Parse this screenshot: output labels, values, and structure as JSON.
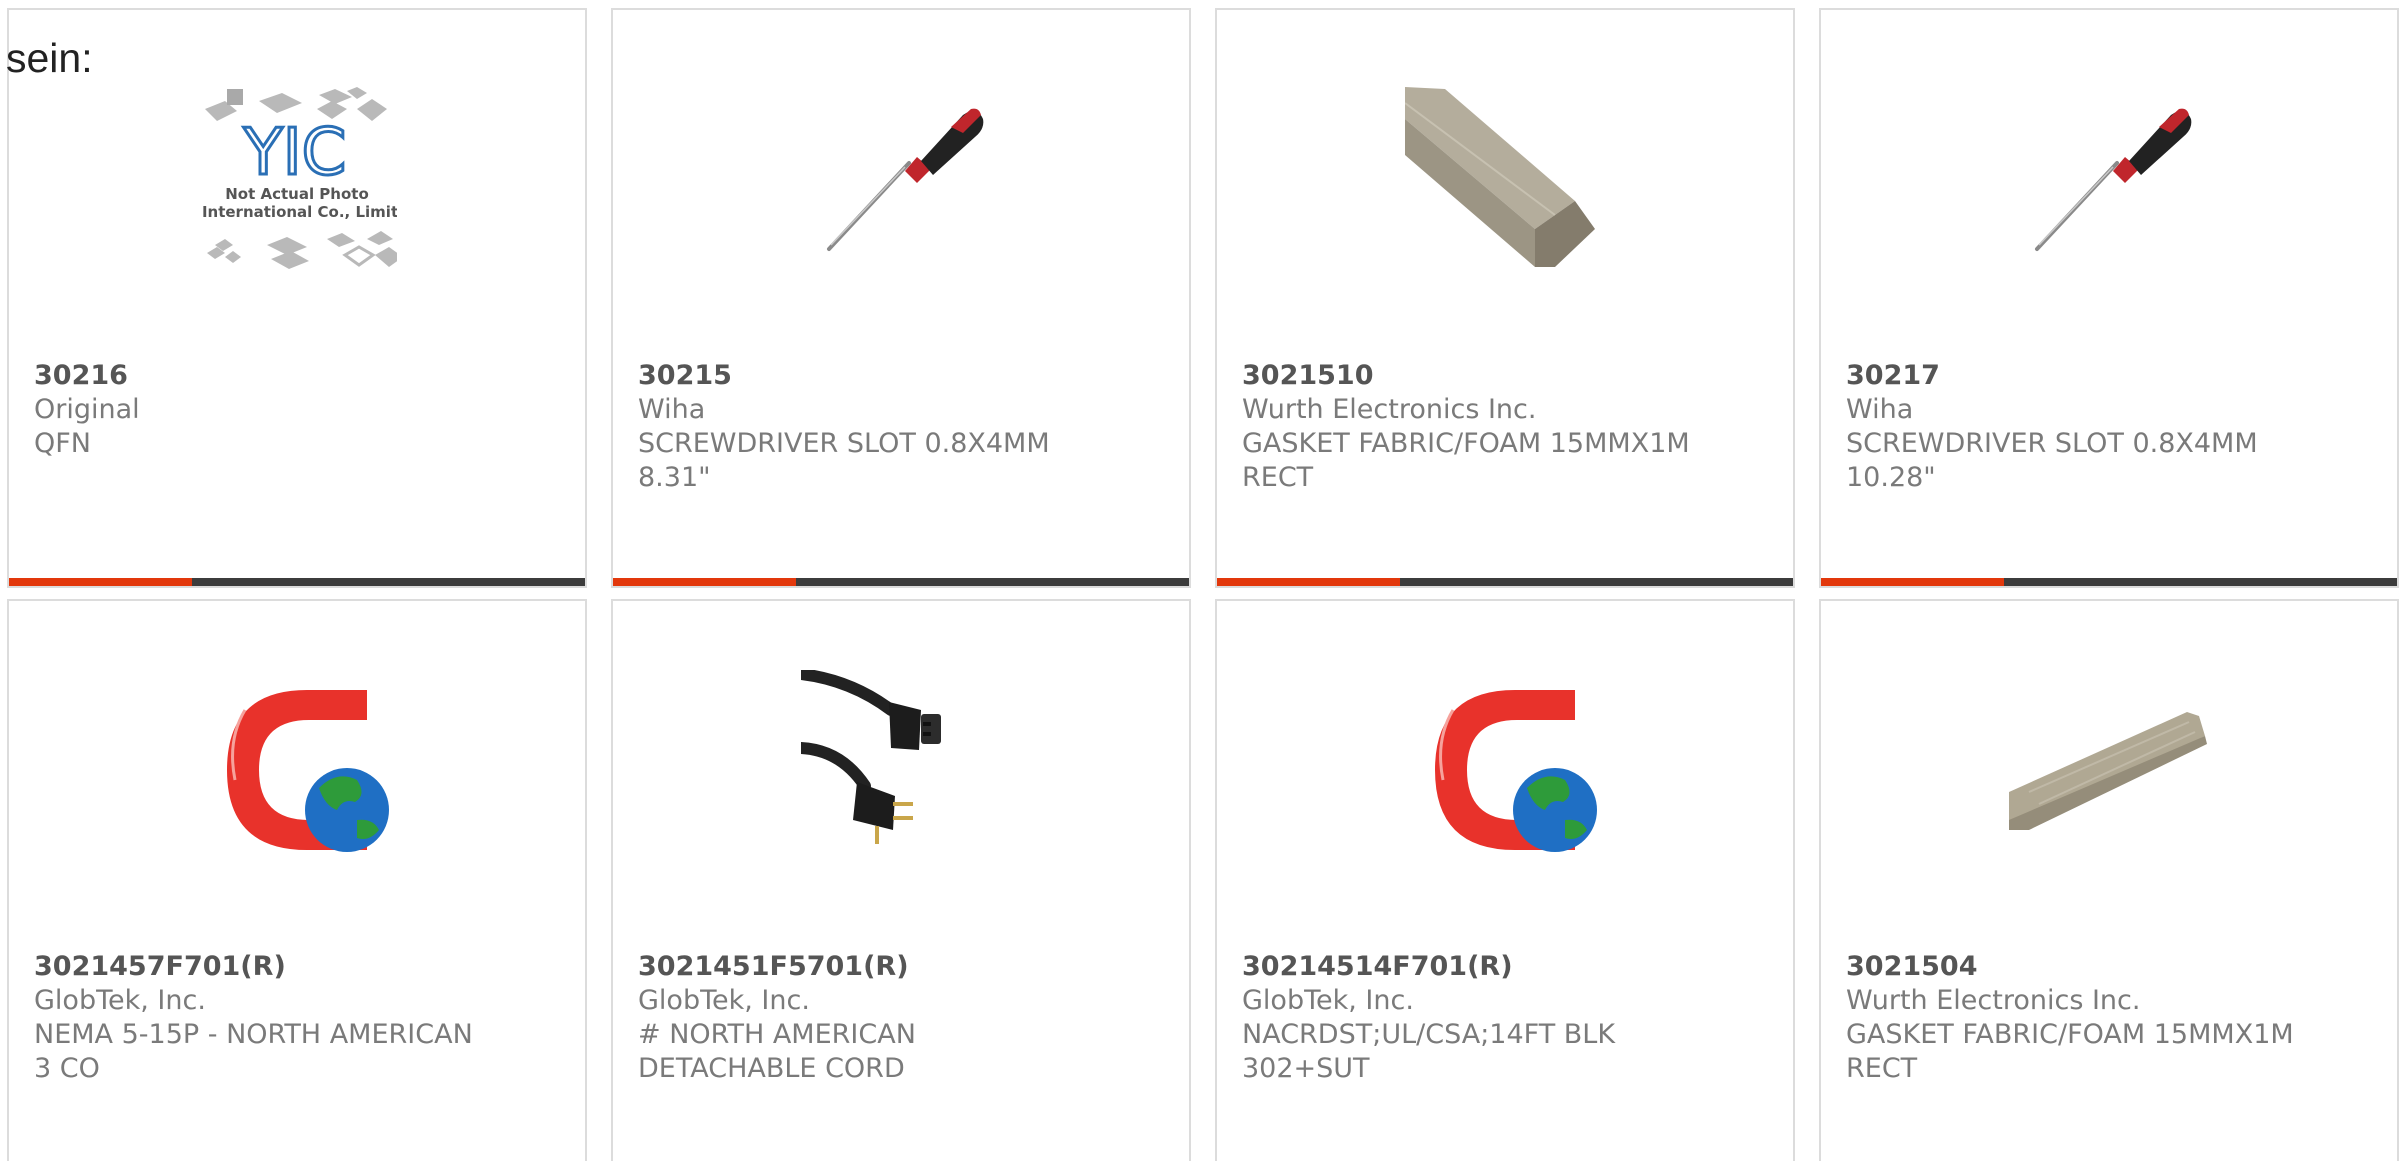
{
  "page_label": "sein:",
  "colors": {
    "accent": "#e2380c",
    "bar": "#3c3c3c",
    "border": "#dcdcdc",
    "text": "#7a7a7a"
  },
  "products": [
    {
      "part_number": "30216",
      "brand": "Original",
      "desc1": "QFN",
      "desc2": "",
      "image": "placeholder",
      "placeholder_lines": [
        "Not Actual Photo",
        "YIC International Co., Limited."
      ],
      "placeholder_logo": "YIC"
    },
    {
      "part_number": "30215",
      "brand": "Wiha",
      "desc1": "SCREWDRIVER SLOT 0.8X4MM",
      "desc2": "8.31\"",
      "image": "screwdriver"
    },
    {
      "part_number": "3021510",
      "brand": "Wurth Electronics Inc.",
      "desc1": "GASKET FABRIC/FOAM 15MMX1M",
      "desc2": "RECT",
      "image": "gasket-bar"
    },
    {
      "part_number": "30217",
      "brand": "Wiha",
      "desc1": "SCREWDRIVER SLOT 0.8X4MM",
      "desc2": "10.28\"",
      "image": "screwdriver"
    },
    {
      "part_number": "3021457F701(R)",
      "brand": "GlobTek, Inc.",
      "desc1": "NEMA 5-15P - NORTH AMERICAN",
      "desc2": "3 CO",
      "image": "globtek-logo"
    },
    {
      "part_number": "3021451F5701(R)",
      "brand": "GlobTek, Inc.",
      "desc1": "# NORTH AMERICAN",
      "desc2": "DETACHABLE CORD",
      "image": "power-cord"
    },
    {
      "part_number": "30214514F701(R)",
      "brand": "GlobTek, Inc.",
      "desc1": "NACRDST;UL/CSA;14FT BLK",
      "desc2": "302+SUT",
      "image": "globtek-logo"
    },
    {
      "part_number": "3021504",
      "brand": "Wurth Electronics Inc.",
      "desc1": "GASKET FABRIC/FOAM 15MMX1M",
      "desc2": "RECT",
      "image": "gasket-strip"
    }
  ]
}
